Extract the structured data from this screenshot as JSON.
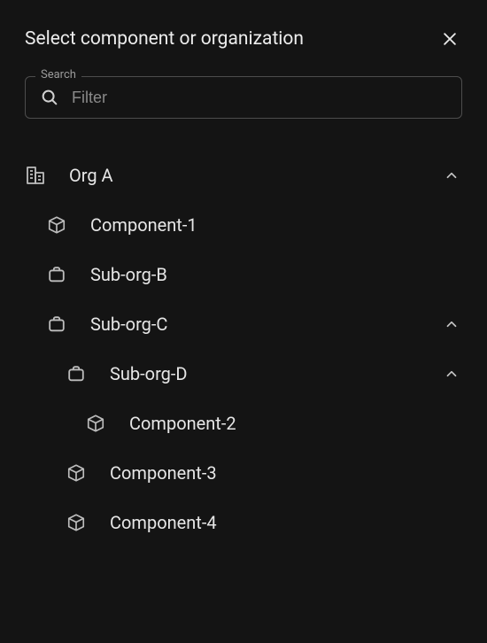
{
  "dialog": {
    "title": "Select component or organization"
  },
  "search": {
    "label": "Search",
    "placeholder": "Filter",
    "value": ""
  },
  "tree": [
    {
      "id": "org-a",
      "depth": 0,
      "kind": "org-root",
      "label": "Org A",
      "expanded": true
    },
    {
      "id": "component-1",
      "depth": 1,
      "kind": "component",
      "label": "Component-1"
    },
    {
      "id": "sub-org-b",
      "depth": 1,
      "kind": "org",
      "label": "Sub-org-B"
    },
    {
      "id": "sub-org-c",
      "depth": 1,
      "kind": "org",
      "label": "Sub-org-C",
      "expanded": true
    },
    {
      "id": "sub-org-d",
      "depth": 2,
      "kind": "org",
      "label": "Sub-org-D",
      "expanded": true
    },
    {
      "id": "component-2",
      "depth": 3,
      "kind": "component",
      "label": "Component-2"
    },
    {
      "id": "component-3",
      "depth": 2,
      "kind": "component",
      "label": "Component-3"
    },
    {
      "id": "component-4",
      "depth": 2,
      "kind": "component",
      "label": "Component-4"
    }
  ]
}
